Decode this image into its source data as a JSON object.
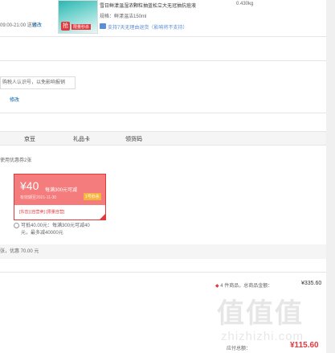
{
  "product": {
    "title": "雪日鲜漾温湿浓颗粒抽蓝松立大无冠抽抗痘液",
    "weight": "0.430kg",
    "spec_label": "规格：鲜漾温洁150ml",
    "return_policy": "支持7天无理由退货（影响将不支持）",
    "img_tag": "抢",
    "img_sale": "限量秒杀"
  },
  "delivery": {
    "time": "09:00-21:00 送达",
    "modify": "修改"
  },
  "notice": "购税人认识号，以免影响报销",
  "invoice_modify": "修改",
  "tabs": [
    "京豆",
    "礼品卡",
    "领货码"
  ],
  "coupon_hint": "使用优惠券2张",
  "coupon": {
    "amount": "¥40",
    "condition": "每满300元可减",
    "valid": "有效期至2021-11-30",
    "badge": "1号秒杀",
    "scope": "[东音] [自营卖] [限量自营]"
  },
  "coupon_note": "可抵40.00元：每满300元可减40元，最多减40000元",
  "discount_summary": "张，优惠 70.00 元",
  "summary": {
    "items": "4 件商品，总商品金额：",
    "items_value": "¥335.60",
    "total_label": "应付总额：",
    "total_value": "¥115.60"
  },
  "watermark": {
    "text": "值值值",
    "url": "zhizhizhi.com"
  }
}
